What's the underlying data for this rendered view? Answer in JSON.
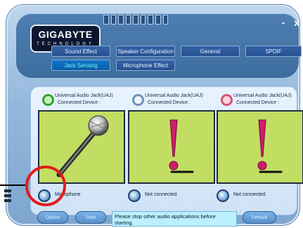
{
  "brand": {
    "name": "GIGABYTE",
    "tagline": "TECHNOLOGY"
  },
  "window_controls": {
    "minimize": "-",
    "close": "x"
  },
  "tabs": [
    {
      "label": "Sound Effect"
    },
    {
      "label": "Speaker Configuration"
    },
    {
      "label": "General"
    },
    {
      "label": "SPDIF"
    },
    {
      "label": "Jack Sensing"
    },
    {
      "label": "Microphone Effect"
    }
  ],
  "jacks": [
    {
      "title": "Universal Audio Jack(UAJ)",
      "subtitle": "Connected Device :",
      "status": "Microphone",
      "ring_color": "#35a12f",
      "device_icon": "microphone-icon"
    },
    {
      "title": "Universal Audio Jack(UAJ)",
      "subtitle": "Connected Device :",
      "status": "Not connected.",
      "ring_color": "#6e91b5",
      "device_icon": "warning-icon"
    },
    {
      "title": "Universal Audio Jack(UAJ)",
      "subtitle": "Connected Device :",
      "status": "Not connected.",
      "ring_color": "#d35475",
      "device_icon": "warning-icon"
    }
  ],
  "bottom": {
    "option_label": "Option",
    "start_label": "Start",
    "message": "Please stop other audio applications before starting.",
    "right_label": "Default"
  },
  "colors": {
    "accent": "#4f7fb2",
    "screen_bg": "#c2de62",
    "highlight_circle": "#e21b1b",
    "exclamation": "#d01c6c"
  }
}
